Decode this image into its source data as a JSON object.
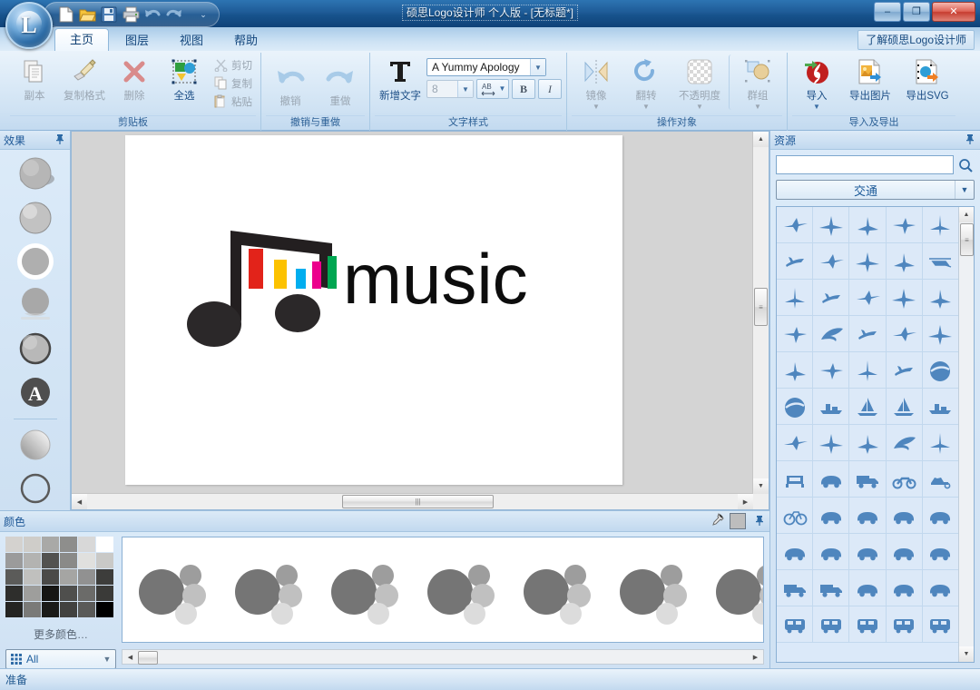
{
  "window": {
    "title": "硕思Logo设计师 个人版 - [无标题*]",
    "minimize": "–",
    "maximize": "❐",
    "close": "✕"
  },
  "quick_access": {
    "items": [
      {
        "name": "new-document",
        "icon": "new-file-icon"
      },
      {
        "name": "open-document",
        "icon": "open-folder-icon"
      },
      {
        "name": "save-document",
        "icon": "save-disk-icon"
      },
      {
        "name": "print-document",
        "icon": "printer-icon"
      },
      {
        "name": "undo",
        "icon": "undo-arrow-icon"
      },
      {
        "name": "redo",
        "icon": "redo-arrow-icon"
      }
    ],
    "customize": "⌄"
  },
  "tabs": [
    {
      "label": "主页",
      "active": true
    },
    {
      "label": "图层",
      "active": false
    },
    {
      "label": "视图",
      "active": false
    },
    {
      "label": "帮助",
      "active": false
    }
  ],
  "learn_link": "了解硕思Logo设计师",
  "ribbon": {
    "groups": [
      {
        "title": "剪贴板",
        "big_buttons": [
          {
            "label": "副本",
            "icon": "duplicate-icon",
            "disabled": true
          },
          {
            "label": "复制格式",
            "icon": "format-painter-icon",
            "disabled": true
          },
          {
            "label": "删除",
            "icon": "delete-x-icon",
            "disabled": true
          },
          {
            "label": "全选",
            "icon": "select-all-icon",
            "disabled": false
          }
        ],
        "small_buttons": [
          {
            "label": "剪切",
            "icon": "scissors-icon",
            "disabled": true
          },
          {
            "label": "复制",
            "icon": "copy-icon",
            "disabled": true
          },
          {
            "label": "粘贴",
            "icon": "paste-icon",
            "disabled": true
          }
        ]
      },
      {
        "title": "撤销与重做",
        "big_buttons": [
          {
            "label": "撤销",
            "icon": "undo-arrow-icon",
            "disabled": true
          },
          {
            "label": "重做",
            "icon": "redo-arrow-icon",
            "disabled": true
          }
        ]
      },
      {
        "title": "文字样式",
        "big_buttons": [
          {
            "label": "新增文字",
            "icon": "add-text-icon",
            "disabled": false
          }
        ],
        "font_name": "A Yummy Apology",
        "font_size": "8",
        "spacing_label": "AB",
        "bold_label": "B",
        "italic_label": "I"
      },
      {
        "title": "操作对象",
        "big_buttons": [
          {
            "label": "镜像",
            "icon": "mirror-icon",
            "disabled": true,
            "dropdown": true
          },
          {
            "label": "翻转",
            "icon": "rotate-icon",
            "disabled": true,
            "dropdown": true
          },
          {
            "label": "不透明度",
            "icon": "opacity-checker-icon",
            "disabled": true,
            "dropdown": true
          },
          {
            "label": "群组",
            "icon": "group-objects-icon",
            "disabled": true,
            "dropdown": true
          }
        ]
      },
      {
        "title": "导入及导出",
        "big_buttons": [
          {
            "label": "导入",
            "icon": "flash-import-icon",
            "disabled": false,
            "dropdown": true
          },
          {
            "label": "导出图片",
            "icon": "export-image-icon",
            "disabled": false
          },
          {
            "label": "导出SVG",
            "icon": "export-svg-icon",
            "disabled": false
          }
        ]
      }
    ]
  },
  "effects_panel": {
    "title": "效果",
    "pin": "📌",
    "items": [
      {
        "name": "effect-drop-shadow"
      },
      {
        "name": "effect-inner-shadow"
      },
      {
        "name": "effect-outer-glow"
      },
      {
        "name": "effect-reflection"
      },
      {
        "name": "effect-stroke"
      },
      {
        "name": "effect-text-mask"
      },
      {
        "name": "effect-gradient-fill"
      },
      {
        "name": "effect-outline-only"
      }
    ]
  },
  "canvas": {
    "logo": {
      "text": "music",
      "bar_colors": [
        "#e2231a",
        "#fcc200",
        "#00aeef",
        "#ec008c",
        "#00a651"
      ],
      "note_color": "#231f20"
    },
    "scroll": {
      "up": "▲",
      "down": "▼",
      "left": "◀",
      "right": "▶",
      "grip": "|||"
    }
  },
  "resources_panel": {
    "title": "资源",
    "pin": "📌",
    "search_value": "",
    "search_placeholder": "",
    "search_icon": "magnifier-icon",
    "category": "交通",
    "category_caret": "▼",
    "icons": [
      "airplane-side-1",
      "airplane-side-2",
      "airplane-x-wing",
      "airplane-top-1",
      "airplane-vertical",
      "airplane-sweep",
      "jet-fighter",
      "jet-top",
      "airliner-top",
      "helicopter",
      "airplane-banking",
      "airplane-cross",
      "airplane-wide",
      "propeller-plane",
      "airplane-thin",
      "airplane-low",
      "swoosh-plane",
      "bomber",
      "seaplane",
      "glider",
      "airplane-small",
      "airplane-delta",
      "airplane-arrow",
      "airplane-tiny",
      "plane-circle",
      "globe-plane",
      "battleship",
      "sailboat-1",
      "sailboat-2",
      "speedboat",
      "cargo-plane",
      "light-aircraft",
      "airliner-front",
      "jet-swoosh",
      "airplane-large",
      "car-front",
      "beetle-car",
      "box-truck",
      "motorcycle",
      "horse-carriage",
      "bicycle",
      "car-outline-1",
      "car-outline-2",
      "car-outline-3",
      "car-outline-4",
      "car-outline-5",
      "sedan-1",
      "sedan-2",
      "sedan-3",
      "sedan-4",
      "truck-1",
      "van-1",
      "car-side-1",
      "car-side-2",
      "car-drift",
      "bus-1",
      "bus-2",
      "tram",
      "train",
      "locomotive"
    ]
  },
  "color_panel": {
    "title": "颜色",
    "eyedropper_icon": "eyedropper-icon",
    "current_color": "#bdbdbd",
    "pin": "📌",
    "swatches": [
      "#d4d2cf",
      "#cfcdc9",
      "#a9a9a7",
      "#8e8e8c",
      "#d8d8d8",
      "#ffffff",
      "#9b9b9b",
      "#b3b3b1",
      "#525250",
      "#8a8a88",
      "#e0e0de",
      "#c9c9c7",
      "#5b5b59",
      "#c0c0be",
      "#4a4a48",
      "#a5a5a3",
      "#919191",
      "#3d3d3b",
      "#2e2e2c",
      "#9e9e9c",
      "#161614",
      "#4f4f4d",
      "#6b6b69",
      "#3a3a38",
      "#242422",
      "#7a7a78",
      "#1b1b19",
      "#424240",
      "#5a5a58",
      "#000000"
    ],
    "more_colors": "更多颜色…",
    "all_label": "All",
    "all_caret": "▼",
    "style_previews": [
      {
        "name": "style-preview-1"
      },
      {
        "name": "style-preview-2"
      },
      {
        "name": "style-preview-3"
      },
      {
        "name": "style-preview-4"
      },
      {
        "name": "style-preview-5"
      },
      {
        "name": "style-preview-6"
      },
      {
        "name": "style-preview-7"
      }
    ]
  },
  "status_bar": {
    "text": "准备"
  }
}
